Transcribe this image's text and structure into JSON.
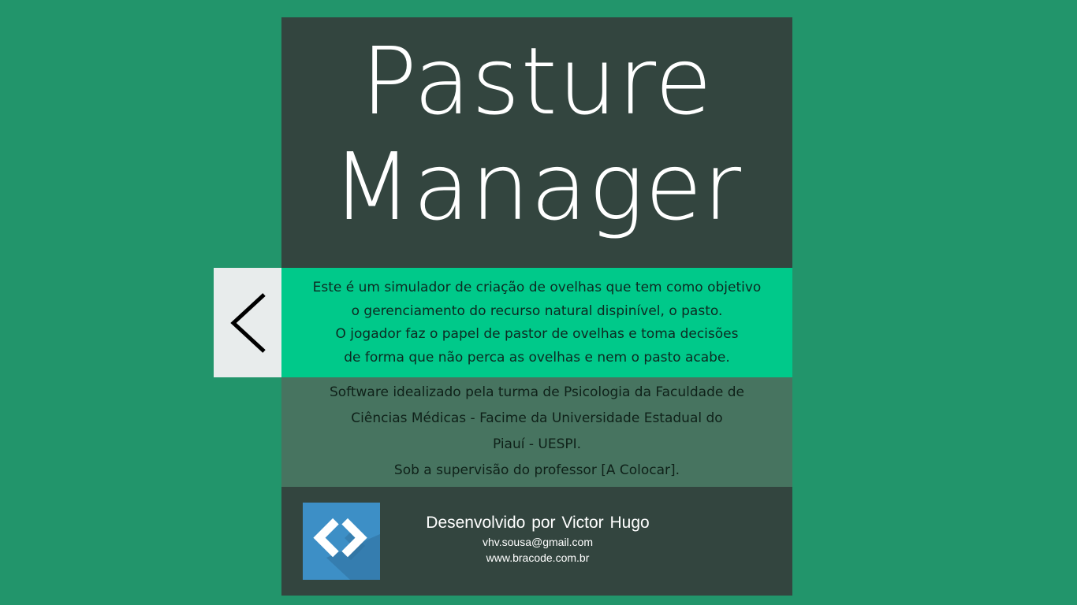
{
  "app": {
    "title_line_1": "Pasture",
    "title_line_2": "Manager"
  },
  "description": {
    "lines": [
      "Este é um simulador de criação de ovelhas que tem como objetivo",
      "o gerenciamento do recurso natural dispinível, o pasto.",
      "O jogador faz o papel de pastor de ovelhas e toma decisões",
      "de forma que não perca as ovelhas e nem o pasto acabe."
    ]
  },
  "credits": {
    "lines": [
      "Software idealizado pela turma de Psicologia da Faculdade de",
      "Ciências Médicas -  Facime da Universidade Estadual do",
      "Piauí - UESPI.",
      "Sob a supervisão do professor [A Colocar]."
    ]
  },
  "developer": {
    "name": "Desenvolvido por Victor Hugo",
    "email": "vhv.sousa@gmail.com",
    "website": "www.bracode.com.br",
    "logo_icon": "code-brackets-icon"
  },
  "navigation": {
    "back_icon": "chevron-left-icon"
  },
  "colors": {
    "background": "#22956b",
    "title_block": "#33453f",
    "description_block": "#00c98a",
    "credits_block": "#477460",
    "back_button": "#e8ecec",
    "logo_tile": "#3d8fc6"
  }
}
